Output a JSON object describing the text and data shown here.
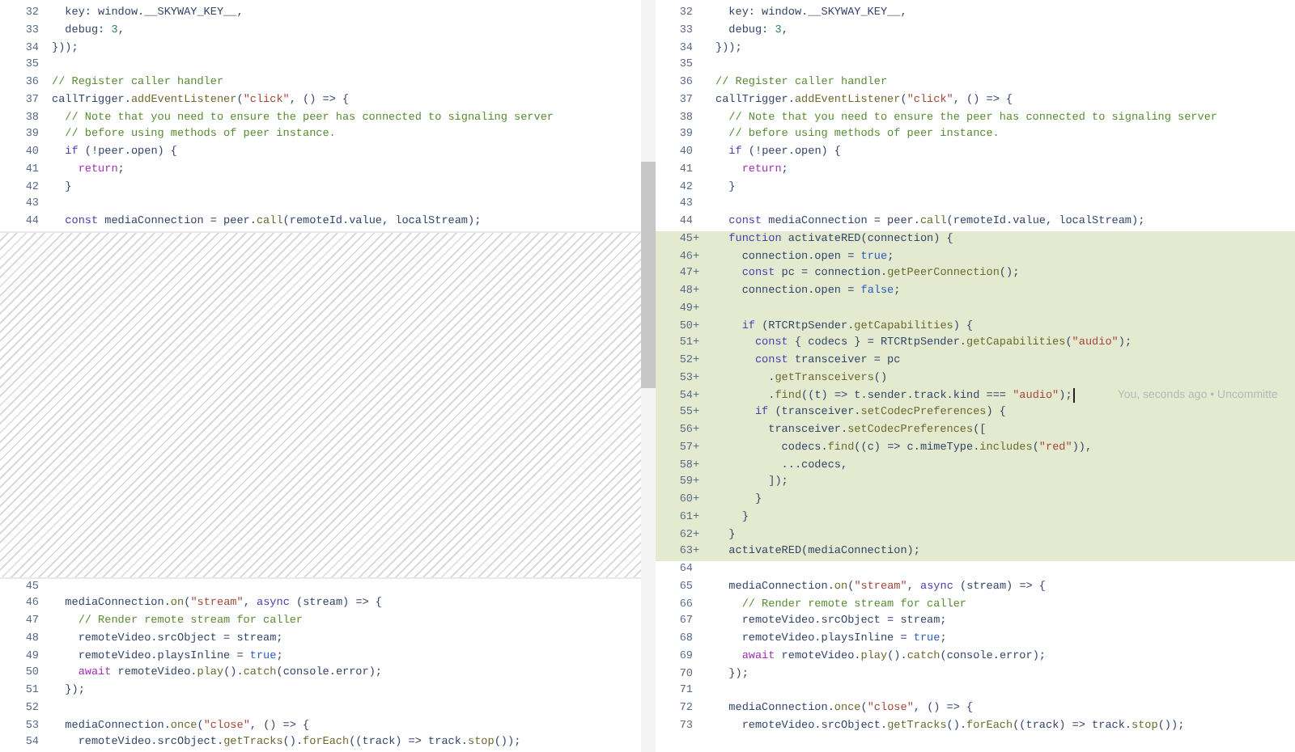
{
  "panes": [
    {
      "items": [
        {
          "kind": "line",
          "number": "32",
          "tokens": [
            {
              "kind": "d",
              "text": "  key: window.__SKYWAY_KEY__,"
            }
          ]
        },
        {
          "kind": "line",
          "number": "33",
          "tokens": [
            {
              "kind": "d",
              "text": "  debug: "
            },
            {
              "kind": "n",
              "text": "3"
            },
            {
              "kind": "d",
              "text": ","
            }
          ]
        },
        {
          "kind": "line",
          "number": "34",
          "tokens": [
            {
              "kind": "d",
              "text": "}));"
            }
          ]
        },
        {
          "kind": "line",
          "number": "35"
        },
        {
          "kind": "line",
          "number": "36",
          "tokens": [
            {
              "kind": "c",
              "text": "// Register caller handler"
            }
          ]
        },
        {
          "kind": "line",
          "number": "37",
          "tokens": [
            {
              "kind": "d",
              "text": "callTrigger."
            },
            {
              "kind": "f",
              "text": "addEventListener"
            },
            {
              "kind": "d",
              "text": "("
            },
            {
              "kind": "s",
              "text": "\"click\""
            },
            {
              "kind": "d",
              "text": ", () => {"
            }
          ]
        },
        {
          "kind": "line",
          "number": "38",
          "tokens": [
            {
              "kind": "c",
              "text": "  // Note that you need to ensure the peer has connected to signaling server"
            }
          ]
        },
        {
          "kind": "line",
          "number": "39",
          "tokens": [
            {
              "kind": "c",
              "text": "  // before using methods of peer instance."
            }
          ]
        },
        {
          "kind": "line",
          "number": "40",
          "tokens": [
            {
              "kind": "k",
              "text": "  if"
            },
            {
              "kind": "d",
              "text": " (!peer.open) {"
            }
          ]
        },
        {
          "kind": "line",
          "number": "41",
          "tokens": [
            {
              "kind": "r",
              "text": "    return"
            },
            {
              "kind": "d",
              "text": ";"
            }
          ]
        },
        {
          "kind": "line",
          "number": "42",
          "tokens": [
            {
              "kind": "d",
              "text": "  }"
            }
          ]
        },
        {
          "kind": "line",
          "number": "43"
        },
        {
          "kind": "line",
          "number": "44",
          "tokens": [
            {
              "kind": "k",
              "text": "  const"
            },
            {
              "kind": "d",
              "text": " mediaConnection = peer."
            },
            {
              "kind": "f",
              "text": "call"
            },
            {
              "kind": "d",
              "text": "(remoteId.value, localStream);"
            }
          ]
        },
        {
          "kind": "gap"
        },
        {
          "kind": "line",
          "number": "45"
        },
        {
          "kind": "line",
          "number": "46",
          "tokens": [
            {
              "kind": "d",
              "text": "  mediaConnection."
            },
            {
              "kind": "f",
              "text": "on"
            },
            {
              "kind": "d",
              "text": "("
            },
            {
              "kind": "s",
              "text": "\"stream\""
            },
            {
              "kind": "d",
              "text": ", "
            },
            {
              "kind": "k",
              "text": "async"
            },
            {
              "kind": "d",
              "text": " (stream) => {"
            }
          ]
        },
        {
          "kind": "line",
          "number": "47",
          "tokens": [
            {
              "kind": "c",
              "text": "    // Render remote stream for caller"
            }
          ]
        },
        {
          "kind": "line",
          "number": "48",
          "tokens": [
            {
              "kind": "d",
              "text": "    remoteVideo.srcObject = stream;"
            }
          ]
        },
        {
          "kind": "line",
          "number": "49",
          "tokens": [
            {
              "kind": "d",
              "text": "    remoteVideo.playsInline = "
            },
            {
              "kind": "b",
              "text": "true"
            },
            {
              "kind": "d",
              "text": ";"
            }
          ]
        },
        {
          "kind": "line",
          "number": "50",
          "tokens": [
            {
              "kind": "r",
              "text": "    await"
            },
            {
              "kind": "d",
              "text": " remoteVideo."
            },
            {
              "kind": "f",
              "text": "play"
            },
            {
              "kind": "d",
              "text": "()."
            },
            {
              "kind": "f",
              "text": "catch"
            },
            {
              "kind": "d",
              "text": "(console.error);"
            }
          ]
        },
        {
          "kind": "line",
          "number": "51",
          "tokens": [
            {
              "kind": "d",
              "text": "  });"
            }
          ]
        },
        {
          "kind": "line",
          "number": "52"
        },
        {
          "kind": "line",
          "number": "53",
          "tokens": [
            {
              "kind": "d",
              "text": "  mediaConnection."
            },
            {
              "kind": "f",
              "text": "once"
            },
            {
              "kind": "d",
              "text": "("
            },
            {
              "kind": "s",
              "text": "\"close\""
            },
            {
              "kind": "d",
              "text": ", () => {"
            }
          ]
        },
        {
          "kind": "line",
          "number": "54",
          "tokens": [
            {
              "kind": "d",
              "text": "    remoteVideo.srcObject."
            },
            {
              "kind": "f",
              "text": "getTracks"
            },
            {
              "kind": "d",
              "text": "()."
            },
            {
              "kind": "f",
              "text": "forEach"
            },
            {
              "kind": "d",
              "text": "((track) => track."
            },
            {
              "kind": "f",
              "text": "stop"
            },
            {
              "kind": "d",
              "text": "());"
            }
          ]
        }
      ]
    },
    {
      "items": [
        {
          "kind": "line",
          "number": "32",
          "added": false,
          "tokens": [
            {
              "kind": "d",
              "text": "  key: window.__SKYWAY_KEY__,"
            }
          ]
        },
        {
          "kind": "line",
          "number": "33",
          "added": false,
          "tokens": [
            {
              "kind": "d",
              "text": "  debug: "
            },
            {
              "kind": "n",
              "text": "3"
            },
            {
              "kind": "d",
              "text": ","
            }
          ]
        },
        {
          "kind": "line",
          "number": "34",
          "added": false,
          "tokens": [
            {
              "kind": "d",
              "text": "}));"
            }
          ]
        },
        {
          "kind": "line",
          "number": "35",
          "added": false
        },
        {
          "kind": "line",
          "number": "36",
          "added": false,
          "tokens": [
            {
              "kind": "c",
              "text": "// Register caller handler"
            }
          ]
        },
        {
          "kind": "line",
          "number": "37",
          "added": false,
          "tokens": [
            {
              "kind": "d",
              "text": "callTrigger."
            },
            {
              "kind": "f",
              "text": "addEventListener"
            },
            {
              "kind": "d",
              "text": "("
            },
            {
              "kind": "s",
              "text": "\"click\""
            },
            {
              "kind": "d",
              "text": ", () => {"
            }
          ]
        },
        {
          "kind": "line",
          "number": "38",
          "added": false,
          "tokens": [
            {
              "kind": "c",
              "text": "  // Note that you need to ensure the peer has connected to signaling server"
            }
          ]
        },
        {
          "kind": "line",
          "number": "39",
          "added": false,
          "tokens": [
            {
              "kind": "c",
              "text": "  // before using methods of peer instance."
            }
          ]
        },
        {
          "kind": "line",
          "number": "40",
          "added": false,
          "tokens": [
            {
              "kind": "k",
              "text": "  if"
            },
            {
              "kind": "d",
              "text": " (!peer.open) {"
            }
          ]
        },
        {
          "kind": "line",
          "number": "41",
          "added": false,
          "tokens": [
            {
              "kind": "r",
              "text": "    return"
            },
            {
              "kind": "d",
              "text": ";"
            }
          ]
        },
        {
          "kind": "line",
          "number": "42",
          "added": false,
          "tokens": [
            {
              "kind": "d",
              "text": "  }"
            }
          ]
        },
        {
          "kind": "line",
          "number": "43",
          "added": false
        },
        {
          "kind": "line",
          "number": "44",
          "added": false,
          "tokens": [
            {
              "kind": "k",
              "text": "  const"
            },
            {
              "kind": "d",
              "text": " mediaConnection = peer."
            },
            {
              "kind": "f",
              "text": "call"
            },
            {
              "kind": "d",
              "text": "(remoteId.value, localStream);"
            }
          ]
        },
        {
          "kind": "line",
          "number": "45",
          "added": true,
          "marker": "+",
          "tokens": [
            {
              "kind": "k",
              "text": "  function"
            },
            {
              "kind": "d",
              "text": " activateRED(connection) {"
            }
          ]
        },
        {
          "kind": "line",
          "number": "46",
          "added": true,
          "marker": "+",
          "tokens": [
            {
              "kind": "d",
              "text": "    connection.open = "
            },
            {
              "kind": "b",
              "text": "true"
            },
            {
              "kind": "d",
              "text": ";"
            }
          ]
        },
        {
          "kind": "line",
          "number": "47",
          "added": true,
          "marker": "+",
          "tokens": [
            {
              "kind": "k",
              "text": "    const"
            },
            {
              "kind": "d",
              "text": " pc = connection."
            },
            {
              "kind": "f",
              "text": "getPeerConnection"
            },
            {
              "kind": "d",
              "text": "();"
            }
          ]
        },
        {
          "kind": "line",
          "number": "48",
          "added": true,
          "marker": "+",
          "tokens": [
            {
              "kind": "d",
              "text": "    connection.open = "
            },
            {
              "kind": "b",
              "text": "false"
            },
            {
              "kind": "d",
              "text": ";"
            }
          ]
        },
        {
          "kind": "line",
          "number": "49",
          "added": true,
          "marker": "+"
        },
        {
          "kind": "line",
          "number": "50",
          "added": true,
          "marker": "+",
          "tokens": [
            {
              "kind": "k",
              "text": "    if"
            },
            {
              "kind": "d",
              "text": " (RTCRtpSender."
            },
            {
              "kind": "f",
              "text": "getCapabilities"
            },
            {
              "kind": "d",
              "text": ") {"
            }
          ]
        },
        {
          "kind": "line",
          "number": "51",
          "added": true,
          "marker": "+",
          "tokens": [
            {
              "kind": "k",
              "text": "      const"
            },
            {
              "kind": "d",
              "text": " { codecs } = RTCRtpSender."
            },
            {
              "kind": "f",
              "text": "getCapabilities"
            },
            {
              "kind": "d",
              "text": "("
            },
            {
              "kind": "s",
              "text": "\"audio\""
            },
            {
              "kind": "d",
              "text": ");"
            }
          ]
        },
        {
          "kind": "line",
          "number": "52",
          "added": true,
          "marker": "+",
          "tokens": [
            {
              "kind": "k",
              "text": "      const"
            },
            {
              "kind": "d",
              "text": " transceiver = pc"
            }
          ]
        },
        {
          "kind": "line",
          "number": "53",
          "added": true,
          "marker": "+",
          "tokens": [
            {
              "kind": "d",
              "text": "        ."
            },
            {
              "kind": "f",
              "text": "getTransceivers"
            },
            {
              "kind": "d",
              "text": "()"
            }
          ]
        },
        {
          "kind": "line",
          "number": "54",
          "added": true,
          "marker": "+",
          "cursor": true,
          "blame": "You, seconds ago • Uncommitte",
          "tokens": [
            {
              "kind": "d",
              "text": "        ."
            },
            {
              "kind": "f",
              "text": "find"
            },
            {
              "kind": "d",
              "text": "((t) => t.sender.track.kind === "
            },
            {
              "kind": "s",
              "text": "\"audio\""
            },
            {
              "kind": "d",
              "text": ");"
            }
          ]
        },
        {
          "kind": "line",
          "number": "55",
          "added": true,
          "marker": "+",
          "tokens": [
            {
              "kind": "k",
              "text": "      if"
            },
            {
              "kind": "d",
              "text": " (transceiver."
            },
            {
              "kind": "f",
              "text": "setCodecPreferences"
            },
            {
              "kind": "d",
              "text": ") {"
            }
          ]
        },
        {
          "kind": "line",
          "number": "56",
          "added": true,
          "marker": "+",
          "tokens": [
            {
              "kind": "d",
              "text": "        transceiver."
            },
            {
              "kind": "f",
              "text": "setCodecPreferences"
            },
            {
              "kind": "d",
              "text": "(["
            }
          ]
        },
        {
          "kind": "line",
          "number": "57",
          "added": true,
          "marker": "+",
          "tokens": [
            {
              "kind": "d",
              "text": "          codecs."
            },
            {
              "kind": "f",
              "text": "find"
            },
            {
              "kind": "d",
              "text": "((c) => c.mimeType."
            },
            {
              "kind": "f",
              "text": "includes"
            },
            {
              "kind": "d",
              "text": "("
            },
            {
              "kind": "s",
              "text": "\"red\""
            },
            {
              "kind": "d",
              "text": ")),"
            }
          ]
        },
        {
          "kind": "line",
          "number": "58",
          "added": true,
          "marker": "+",
          "tokens": [
            {
              "kind": "d",
              "text": "          ...codecs,"
            }
          ]
        },
        {
          "kind": "line",
          "number": "59",
          "added": true,
          "marker": "+",
          "tokens": [
            {
              "kind": "d",
              "text": "        ]);"
            }
          ]
        },
        {
          "kind": "line",
          "number": "60",
          "added": true,
          "marker": "+",
          "tokens": [
            {
              "kind": "d",
              "text": "      }"
            }
          ]
        },
        {
          "kind": "line",
          "number": "61",
          "added": true,
          "marker": "+",
          "tokens": [
            {
              "kind": "d",
              "text": "    }"
            }
          ]
        },
        {
          "kind": "line",
          "number": "62",
          "added": true,
          "marker": "+",
          "tokens": [
            {
              "kind": "d",
              "text": "  }"
            }
          ]
        },
        {
          "kind": "line",
          "number": "63",
          "added": true,
          "marker": "+",
          "tokens": [
            {
              "kind": "d",
              "text": "  activateRED(mediaConnection);"
            }
          ]
        },
        {
          "kind": "line",
          "number": "64",
          "added": false
        },
        {
          "kind": "line",
          "number": "65",
          "added": false,
          "tokens": [
            {
              "kind": "d",
              "text": "  mediaConnection."
            },
            {
              "kind": "f",
              "text": "on"
            },
            {
              "kind": "d",
              "text": "("
            },
            {
              "kind": "s",
              "text": "\"stream\""
            },
            {
              "kind": "d",
              "text": ", "
            },
            {
              "kind": "k",
              "text": "async"
            },
            {
              "kind": "d",
              "text": " (stream) => {"
            }
          ]
        },
        {
          "kind": "line",
          "number": "66",
          "added": false,
          "tokens": [
            {
              "kind": "c",
              "text": "    // Render remote stream for caller"
            }
          ]
        },
        {
          "kind": "line",
          "number": "67",
          "added": false,
          "tokens": [
            {
              "kind": "d",
              "text": "    remoteVideo.srcObject = stream;"
            }
          ]
        },
        {
          "kind": "line",
          "number": "68",
          "added": false,
          "tokens": [
            {
              "kind": "d",
              "text": "    remoteVideo.playsInline = "
            },
            {
              "kind": "b",
              "text": "true"
            },
            {
              "kind": "d",
              "text": ";"
            }
          ]
        },
        {
          "kind": "line",
          "number": "69",
          "added": false,
          "tokens": [
            {
              "kind": "r",
              "text": "    await"
            },
            {
              "kind": "d",
              "text": " remoteVideo."
            },
            {
              "kind": "f",
              "text": "play"
            },
            {
              "kind": "d",
              "text": "()."
            },
            {
              "kind": "f",
              "text": "catch"
            },
            {
              "kind": "d",
              "text": "(console.error);"
            }
          ]
        },
        {
          "kind": "line",
          "number": "70",
          "added": false,
          "tokens": [
            {
              "kind": "d",
              "text": "  });"
            }
          ]
        },
        {
          "kind": "line",
          "number": "71",
          "added": false
        },
        {
          "kind": "line",
          "number": "72",
          "added": false,
          "tokens": [
            {
              "kind": "d",
              "text": "  mediaConnection."
            },
            {
              "kind": "f",
              "text": "once"
            },
            {
              "kind": "d",
              "text": "("
            },
            {
              "kind": "s",
              "text": "\"close\""
            },
            {
              "kind": "d",
              "text": ", () => {"
            }
          ]
        },
        {
          "kind": "line",
          "number": "73",
          "added": false,
          "tokens": [
            {
              "kind": "d",
              "text": "    remoteVideo.srcObject."
            },
            {
              "kind": "f",
              "text": "getTracks"
            },
            {
              "kind": "d",
              "text": "()."
            },
            {
              "kind": "f",
              "text": "forEach"
            },
            {
              "kind": "d",
              "text": "((track) => track."
            },
            {
              "kind": "f",
              "text": "stop"
            },
            {
              "kind": "d",
              "text": "());"
            }
          ]
        }
      ]
    }
  ]
}
